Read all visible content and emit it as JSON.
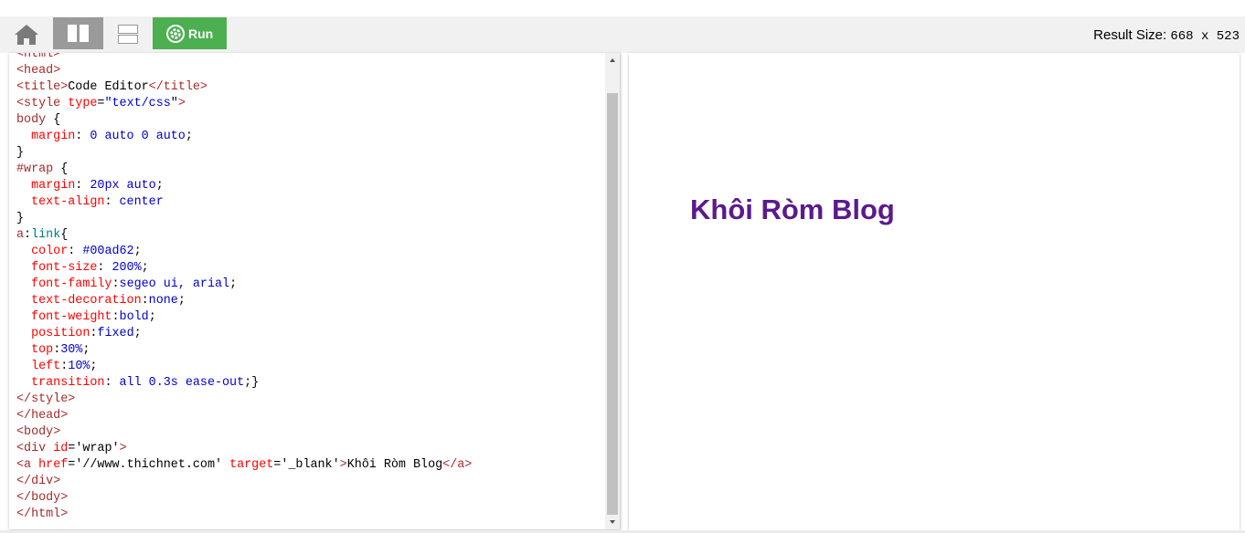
{
  "toolbar": {
    "home_icon": "home-icon",
    "columns_icon": "columns-layout-icon",
    "rows_icon": "rows-layout-icon",
    "run_icon": "gear-icon",
    "run_label": "Run",
    "result_size_label": "Result Size:",
    "result_size_value": "668 x 523"
  },
  "editor": {
    "lines": [
      "<html>",
      "<head>",
      "<title>Code Editor</title>",
      "<style type=\"text/css\">",
      "body {",
      "  margin: 0 auto 0 auto;",
      "}",
      "#wrap {",
      "  margin: 20px auto;",
      "  text-align: center",
      "}",
      "a:link{",
      "  color: #00ad62;",
      "  font-size: 200%;",
      "  font-family:segeo ui, arial;",
      "  text-decoration:none;",
      "  font-weight:bold;",
      "  position:fixed;",
      "  top:30%;",
      "  left:10%;",
      "  transition: all 0.3s ease-out;}",
      "</style>",
      "</head>",
      "<body>",
      "<div id='wrap'>",
      "<a href='//www.thichnet.com' target='_blank'>Khôi Ròm Blog</a>",
      "</div>",
      "</body>",
      "</html>"
    ]
  },
  "result": {
    "link_text": "Khôi Ròm Blog",
    "link_color": "#5b1a8c"
  },
  "colors": {
    "run_button": "#4caf50",
    "active_layout": "#9a9a9a",
    "tag": "#a52a2a",
    "property": "#ff0000",
    "value": "#0000cd"
  }
}
